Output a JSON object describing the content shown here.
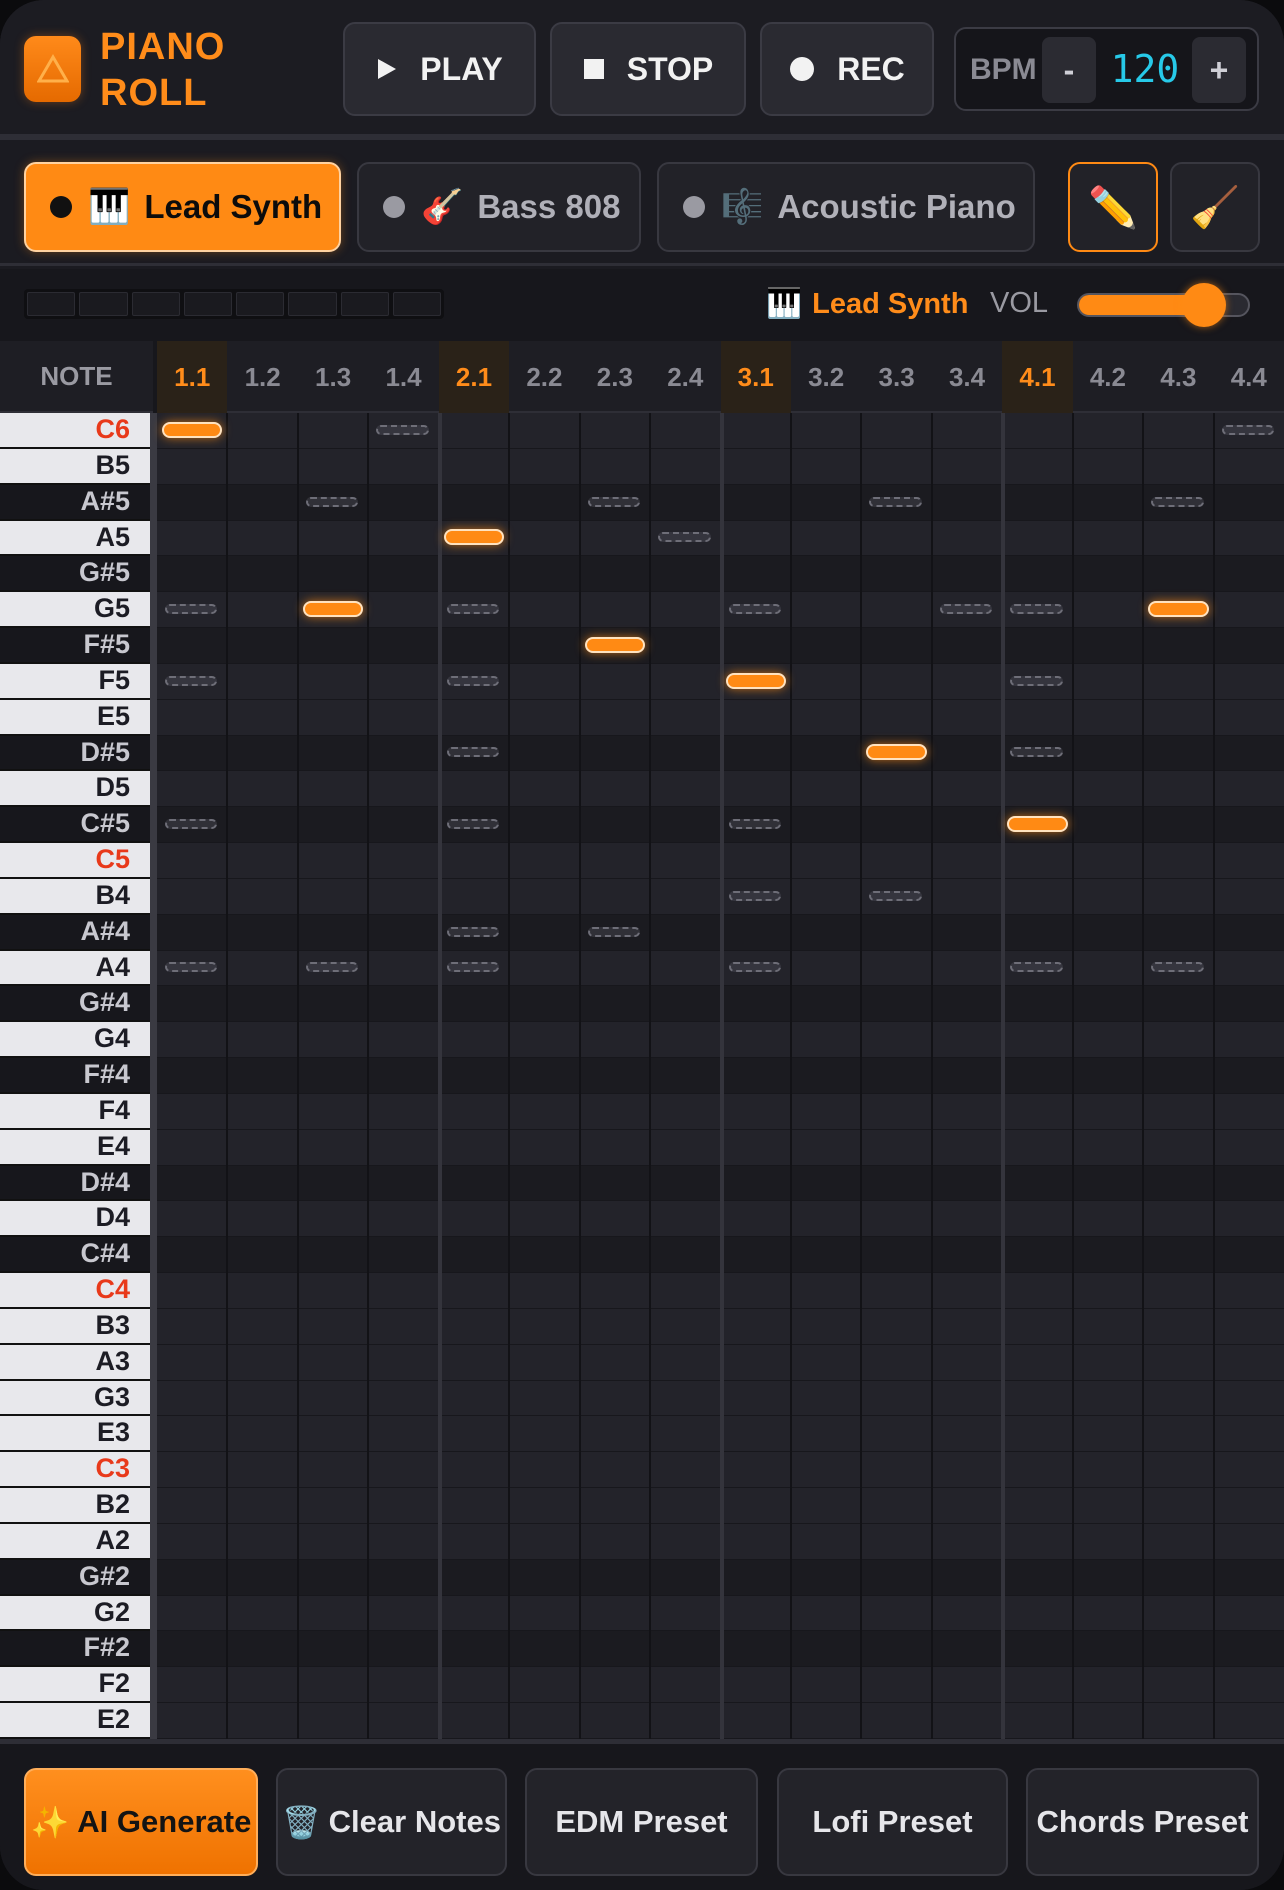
{
  "header": {
    "title": "PIANO ROLL",
    "logo_icon": "triangle-logo-icon",
    "transport": {
      "play": "PLAY",
      "stop": "STOP",
      "rec": "REC"
    },
    "bpm": {
      "label": "BPM",
      "minus": "-",
      "value": "120",
      "plus": "+"
    }
  },
  "instruments": [
    {
      "emoji": "🎹",
      "name": "Lead Synth",
      "active": true
    },
    {
      "emoji": "🎸",
      "name": "Bass 808",
      "active": false
    },
    {
      "emoji": "🎼",
      "name": "Acoustic Piano",
      "active": false
    }
  ],
  "tools": {
    "pencil": "✏️",
    "broom": "🧹"
  },
  "status": {
    "current_emoji": "🎹",
    "current_instrument": "Lead Synth",
    "vol_label": "VOL",
    "volume": 0.72
  },
  "grid": {
    "note_header": "NOTE",
    "beats": [
      "1.1",
      "1.2",
      "1.3",
      "1.4",
      "2.1",
      "2.2",
      "2.3",
      "2.4",
      "3.1",
      "3.2",
      "3.3",
      "3.4",
      "4.1",
      "4.2",
      "4.3",
      "4.4"
    ],
    "keys": [
      "C6",
      "B5",
      "A#5",
      "A5",
      "G#5",
      "G5",
      "F#5",
      "F5",
      "E5",
      "D#5",
      "D5",
      "C#5",
      "C5",
      "B4",
      "A#4",
      "A4",
      "G#4",
      "G4",
      "F#4",
      "F4",
      "E4",
      "D#4",
      "D4",
      "C#4",
      "C4",
      "B3",
      "A3",
      "G3",
      "E3",
      "C3",
      "B2",
      "A2",
      "G#2",
      "G2",
      "F#2",
      "F2",
      "E2"
    ],
    "notes": [
      {
        "pitch": "C6",
        "step": 0
      },
      {
        "pitch": "G5",
        "step": 2
      },
      {
        "pitch": "A5",
        "step": 4
      },
      {
        "pitch": "F#5",
        "step": 6
      },
      {
        "pitch": "F5",
        "step": 8
      },
      {
        "pitch": "D#5",
        "step": 10
      },
      {
        "pitch": "C#5",
        "step": 12
      },
      {
        "pitch": "G5",
        "step": 14
      }
    ],
    "ghost_notes": [
      {
        "pitch": "C6",
        "step": 3
      },
      {
        "pitch": "C6",
        "step": 15
      },
      {
        "pitch": "A#5",
        "step": 2
      },
      {
        "pitch": "A#5",
        "step": 6
      },
      {
        "pitch": "A#5",
        "step": 10
      },
      {
        "pitch": "A#5",
        "step": 14
      },
      {
        "pitch": "A5",
        "step": 7
      },
      {
        "pitch": "G5",
        "step": 0
      },
      {
        "pitch": "G5",
        "step": 4
      },
      {
        "pitch": "G5",
        "step": 8
      },
      {
        "pitch": "G5",
        "step": 11
      },
      {
        "pitch": "G5",
        "step": 12
      },
      {
        "pitch": "F5",
        "step": 0
      },
      {
        "pitch": "F5",
        "step": 4
      },
      {
        "pitch": "F5",
        "step": 12
      },
      {
        "pitch": "D#5",
        "step": 4
      },
      {
        "pitch": "D#5",
        "step": 12
      },
      {
        "pitch": "C#5",
        "step": 0
      },
      {
        "pitch": "C#5",
        "step": 4
      },
      {
        "pitch": "C#5",
        "step": 8
      },
      {
        "pitch": "B4",
        "step": 8
      },
      {
        "pitch": "B4",
        "step": 10
      },
      {
        "pitch": "A#4",
        "step": 4
      },
      {
        "pitch": "A#4",
        "step": 6
      },
      {
        "pitch": "A4",
        "step": 12
      },
      {
        "pitch": "A4",
        "step": 14
      },
      {
        "pitch": "A4",
        "step": 0
      },
      {
        "pitch": "A4",
        "step": 2
      },
      {
        "pitch": "A4",
        "step": 4
      },
      {
        "pitch": "A4",
        "step": 8
      }
    ]
  },
  "footer": {
    "ai_emoji": "✨",
    "ai_label": "AI Generate",
    "clear_emoji": "🗑️",
    "clear_label": "Clear Notes",
    "edm": "EDM Preset",
    "lofi": "Lofi Preset",
    "chords": "Chords Preset"
  },
  "colors": {
    "accent": "#ff8a14",
    "bpm_value": "#27c9e8",
    "c_key": "#e8391a",
    "background": "#1b1b21"
  }
}
